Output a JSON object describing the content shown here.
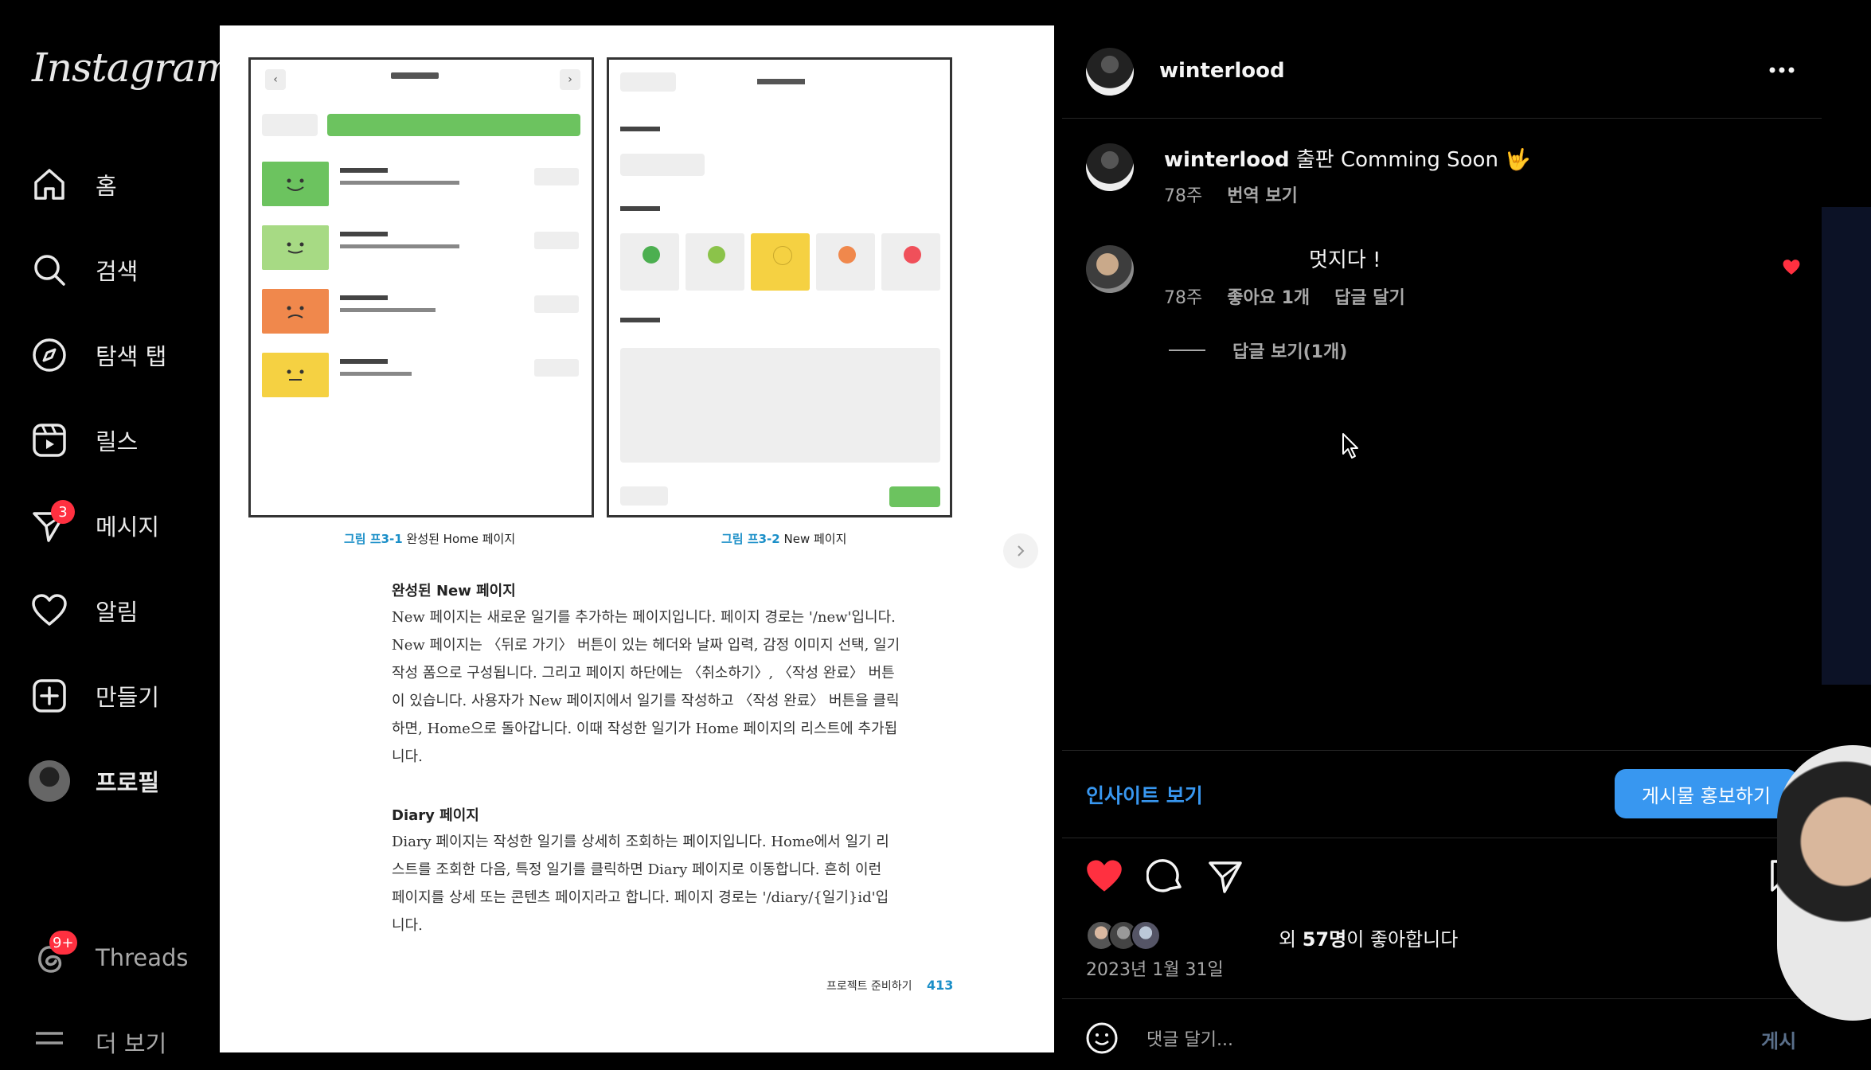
{
  "sidebar": {
    "logo": "Instagram",
    "items": [
      {
        "label": "홈",
        "icon": "home-icon"
      },
      {
        "label": "검색",
        "icon": "search-icon"
      },
      {
        "label": "탐색 탭",
        "icon": "compass-icon"
      },
      {
        "label": "릴스",
        "icon": "reels-icon"
      },
      {
        "label": "메시지",
        "icon": "messenger-icon",
        "badge": "3"
      },
      {
        "label": "알림",
        "icon": "heart-icon"
      },
      {
        "label": "만들기",
        "icon": "plus-square-icon"
      },
      {
        "label": "프로필",
        "icon": "profile-avatar"
      }
    ],
    "threads": {
      "label": "Threads",
      "badge": "9+"
    },
    "more": {
      "label": "더 보기"
    }
  },
  "book": {
    "captions": [
      {
        "num": "그림 프3-1",
        "text": "완성된 Home 페이지"
      },
      {
        "num": "그림 프3-2",
        "text": "New 페이지"
      }
    ],
    "section1_title": "완성된 New 페이지",
    "section1_lines": [
      "New 페이지는 새로운 일기를 추가하는 페이지입니다. 페이지 경로는 '/new'입니다.",
      "New 페이지는 〈뒤로 가기〉 버튼이 있는 헤더와 날짜 입력, 감정 이미지 선택, 일기",
      "작성 폼으로 구성됩니다. 그리고 페이지 하단에는 〈취소하기〉, 〈작성 완료〉 버튼",
      "이 있습니다. 사용자가 New 페이지에서 일기를 작성하고 〈작성 완료〉 버튼을 클릭",
      "하면, Home으로 돌아갑니다. 이때 작성한 일기가 Home 페이지의 리스트에 추가됩",
      "니다."
    ],
    "section2_title": "Diary 페이지",
    "section2_lines": [
      "Diary 페이지는 작성한 일기를 상세히 조회하는 페이지입니다. Home에서 일기 리",
      "스트를 조회한 다음, 특정 일기를 클릭하면 Diary 페이지로 이동합니다. 흔히 이런",
      "페이지를 상세 또는 콘텐츠 페이지라고 합니다. 페이지 경로는 '/diary/{일기}id'입",
      "니다."
    ],
    "footer_text": "프로젝트 준비하기",
    "page_number": "413"
  },
  "post": {
    "username": "winterlood",
    "caption_username": "winterlood",
    "caption_text": "출판 Comming Soon 🤟",
    "caption_age": "78주",
    "translate": "번역 보기",
    "comment_text": "멋지다 !",
    "comment_age": "78주",
    "comment_likes": "좋아요 1개",
    "comment_reply": "답글 달기",
    "view_replies": "답글 보기(1개)",
    "insights": "인사이트 보기",
    "promote": "게시물 홍보하기",
    "likes_prefix": "외",
    "likes_count": "57명",
    "likes_suffix": "이 좋아합니다",
    "date": "2023년 1월 31일",
    "comment_placeholder": "댓글 달기...",
    "post_button": "게시"
  },
  "colors": {
    "like_red": "#ff3040",
    "accent_blue": "#3897f0",
    "mock_green": "#6cc35f"
  }
}
